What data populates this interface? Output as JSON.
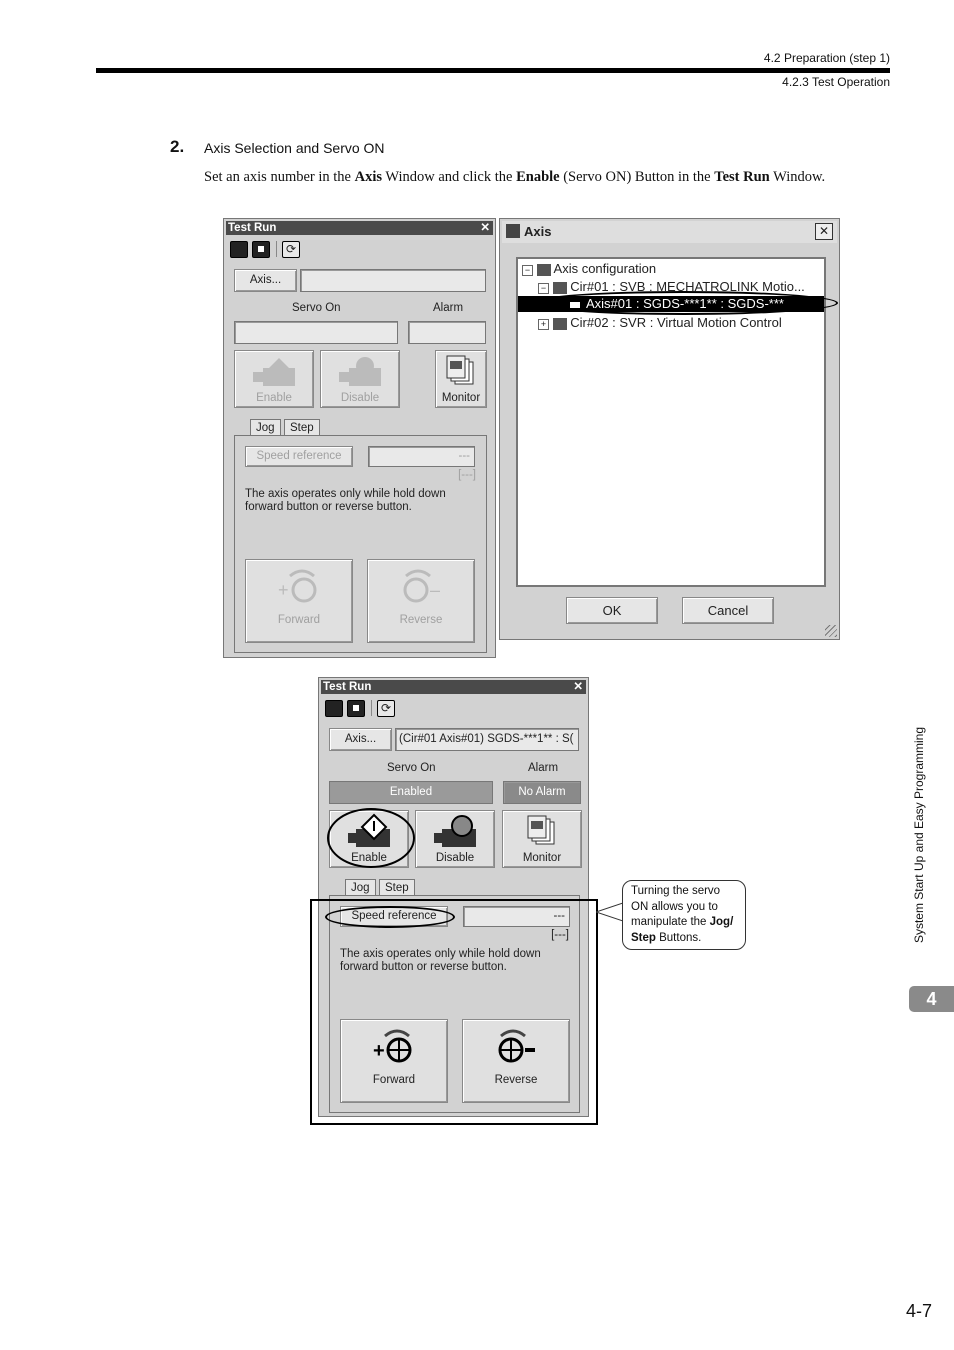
{
  "header": {
    "section": "4.2  Preparation (step 1)",
    "subsection": "4.2.3  Test Operation"
  },
  "step": {
    "number": "2.",
    "title": "Axis Selection and Servo ON",
    "body_parts": [
      "Set an axis number in the ",
      "Axis",
      " Window and click the ",
      "Enable",
      " (Servo ON) Button in the ",
      "Test Run",
      " Window."
    ]
  },
  "dialog1": {
    "title": "Test Run",
    "axis_button": "Axis...",
    "axis_value": "",
    "servo_on_label": "Servo On",
    "alarm_label": "Alarm",
    "servo_value": "",
    "alarm_value": "",
    "enable": "Enable",
    "disable": "Disable",
    "monitor": "Monitor",
    "tab_jog": "Jog",
    "tab_step": "Step",
    "speed_reference": "Speed reference",
    "speed_value": "---",
    "unit": "[---]",
    "description_line1": "The axis operates only while hold down",
    "description_line2": "forward button or reverse button.",
    "forward": "Forward",
    "reverse": "Reverse"
  },
  "axis_window": {
    "title": "Axis",
    "tree": [
      "Axis configuration",
      "Cir#01 : SVB : MECHATROLINK Motio...",
      "Axis#01 : SGDS-***1** : SGDS-***",
      "Cir#02 : SVR : Virtual Motion Control"
    ],
    "ok": "OK",
    "cancel": "Cancel"
  },
  "dialog2": {
    "title": "Test Run",
    "axis_button": "Axis...",
    "axis_value": "(Cir#01 Axis#01) SGDS-***1** : S(",
    "servo_on_label": "Servo On",
    "alarm_label": "Alarm",
    "servo_value": "Enabled",
    "alarm_value": "No Alarm",
    "enable": "Enable",
    "disable": "Disable",
    "monitor": "Monitor",
    "tab_jog": "Jog",
    "tab_step": "Step",
    "speed_reference": "Speed reference",
    "speed_value": "---",
    "unit": "[---]",
    "description_line1": "The axis operates only while hold down",
    "description_line2": "forward button or reverse button.",
    "forward": "Forward",
    "reverse": "Reverse"
  },
  "callout": {
    "line1": "Turning the servo",
    "line2": "ON allows you to",
    "line3_pre": "manipulate the ",
    "line3_bold": "Jog/",
    "line4_bold": "Step",
    "line4_post": " Buttons."
  },
  "side_tab": {
    "text": "System Start Up and Easy Programming",
    "chapter": "4"
  },
  "page_number": "4-7"
}
